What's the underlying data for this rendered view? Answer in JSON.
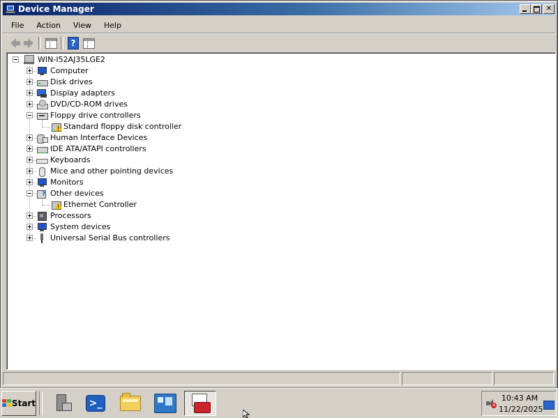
{
  "window": {
    "title": "Device Manager"
  },
  "menu": [
    "File",
    "Action",
    "View",
    "Help"
  ],
  "toolbar": {
    "back_icon": "back-arrow-icon",
    "forward_icon": "forward-arrow-icon",
    "console_tree_icon": "show-hide-console-tree-icon",
    "help_icon": "help-icon",
    "properties_icon": "properties-pane-icon",
    "help_glyph": "?"
  },
  "tree": {
    "root": "WIN-I52AJ35LGE2",
    "items": [
      {
        "label": "Computer",
        "icon": "computer-icon",
        "expanded": false
      },
      {
        "label": "Disk drives",
        "icon": "disk-drive-icon",
        "expanded": false
      },
      {
        "label": "Display adapters",
        "icon": "display-adapter-icon",
        "expanded": false
      },
      {
        "label": "DVD/CD-ROM drives",
        "icon": "dvd-drive-icon",
        "expanded": false
      },
      {
        "label": "Floppy drive controllers",
        "icon": "floppy-controller-icon",
        "expanded": true,
        "children": [
          {
            "label": "Standard floppy disk controller",
            "icon": "warning-device-icon"
          }
        ]
      },
      {
        "label": "Human Interface Devices",
        "icon": "hid-icon",
        "expanded": false
      },
      {
        "label": "IDE ATA/ATAPI controllers",
        "icon": "ide-controller-icon",
        "expanded": false
      },
      {
        "label": "Keyboards",
        "icon": "keyboard-icon",
        "expanded": false
      },
      {
        "label": "Mice and other pointing devices",
        "icon": "mouse-icon",
        "expanded": false
      },
      {
        "label": "Monitors",
        "icon": "monitor-icon",
        "expanded": false
      },
      {
        "label": "Other devices",
        "icon": "other-devices-icon",
        "expanded": true,
        "children": [
          {
            "label": "Ethernet Controller",
            "icon": "warning-device-icon"
          }
        ]
      },
      {
        "label": "Processors",
        "icon": "processor-icon",
        "expanded": false
      },
      {
        "label": "System devices",
        "icon": "system-devices-icon",
        "expanded": false
      },
      {
        "label": "Universal Serial Bus controllers",
        "icon": "usb-icon",
        "expanded": false
      }
    ]
  },
  "taskbar": {
    "start_label": "Start",
    "tasks": [
      {
        "name": "server-manager-icon"
      },
      {
        "name": "powershell-icon"
      },
      {
        "name": "windows-explorer-icon"
      },
      {
        "name": "control-panel-icon"
      },
      {
        "name": "device-manager-icon",
        "active": true
      }
    ],
    "clock_time": "10:43 AM",
    "clock_date": "11/22/2025"
  }
}
